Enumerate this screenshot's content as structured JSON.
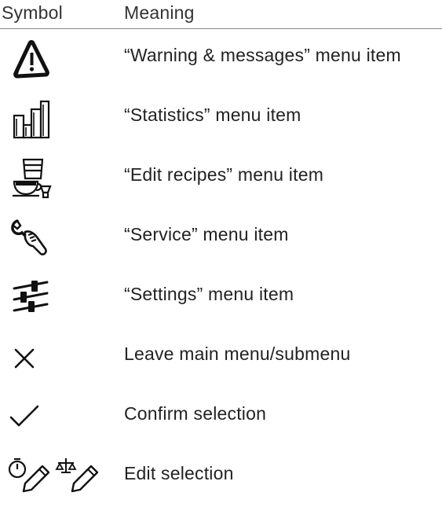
{
  "header": {
    "symbol": "Symbol",
    "meaning": "Meaning"
  },
  "rows": [
    {
      "icon": "warning-icon",
      "meaning": "“Warning & messages” menu item"
    },
    {
      "icon": "statistics-icon",
      "meaning": "“Statistics” menu item"
    },
    {
      "icon": "edit-recipes-icon",
      "meaning": "“Edit recipes” menu item"
    },
    {
      "icon": "service-icon",
      "meaning": "“Service” menu item"
    },
    {
      "icon": "settings-icon",
      "meaning": "“Settings” menu item"
    },
    {
      "icon": "close-icon",
      "meaning": "Leave main menu/submenu"
    },
    {
      "icon": "checkmark-icon",
      "meaning": "Confirm selection"
    },
    {
      "icon": "edit-selection-icons",
      "meaning": "Edit selection"
    }
  ]
}
